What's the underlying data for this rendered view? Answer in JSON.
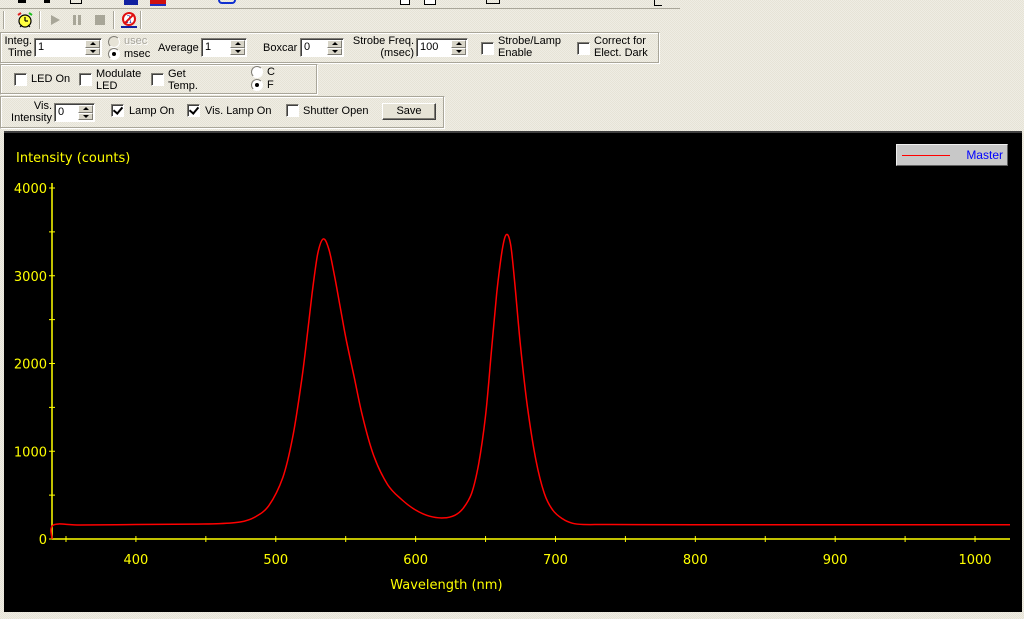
{
  "toolbar_top": {
    "icons": [
      "toolbar-icon-1",
      "toolbar-icon-2",
      "toolbar-icon-3",
      "toolbar-icon-4",
      "toolbar-icon-5",
      "toolbar-icon-6"
    ]
  },
  "toolbar_acq": {
    "buttons": [
      {
        "name": "timer-button",
        "icon": "alarm-clock-icon",
        "enabled": true
      },
      {
        "name": "play-button",
        "icon": "play-icon",
        "enabled": false
      },
      {
        "name": "pause-button",
        "icon": "pause-icon",
        "enabled": false
      },
      {
        "name": "stop-button",
        "icon": "stop-icon",
        "enabled": false
      },
      {
        "name": "no-lambda-button",
        "icon": "no-lambda-icon",
        "enabled": true
      }
    ]
  },
  "acquisition": {
    "integ_time_label_1": "Integ.",
    "integ_time_label_2": "Time",
    "integ_time_value": "1",
    "unit_usec": "usec",
    "unit_msec": "msec",
    "unit_selected": "msec",
    "average_label": "Average",
    "average_value": "1",
    "boxcar_label": "Boxcar",
    "boxcar_value": "0",
    "strobe_freq_label_1": "Strobe Freq.",
    "strobe_freq_label_2": "(msec)",
    "strobe_freq_value": "100",
    "strobe_lamp_label_1": "Strobe/Lamp",
    "strobe_lamp_label_2": "Enable",
    "strobe_lamp_checked": false,
    "correct_dark_label_1": "Correct for",
    "correct_dark_label_2": "Elect. Dark",
    "correct_dark_checked": false
  },
  "led": {
    "led_on_label": "LED On",
    "led_on_checked": false,
    "modulate_label_1": "Modulate",
    "modulate_label_2": "LED",
    "modulate_checked": false,
    "get_temp_label_1": "Get",
    "get_temp_label_2": "Temp.",
    "get_temp_checked": false,
    "temp_c_label": "C",
    "temp_f_label": "F",
    "temp_selected": "F"
  },
  "lamp": {
    "vis_intensity_label_1": "Vis.",
    "vis_intensity_label_2": "Intensity",
    "vis_intensity_value": "0",
    "lamp_on_label": "Lamp On",
    "lamp_on_checked": true,
    "vis_lamp_on_label": "Vis. Lamp On",
    "vis_lamp_on_checked": true,
    "shutter_open_label": "Shutter Open",
    "shutter_open_checked": false,
    "save_label": "Save"
  },
  "colors": {
    "plot_background": "#000000",
    "axis_color": "#ffff00",
    "series_color": "#ff0000",
    "legend_text": "#0000ff"
  },
  "chart_data": {
    "type": "line",
    "title": "",
    "ylabel": "Intensity (counts)",
    "xlabel": "Wavelength (nm)",
    "xlim": [
      340,
      1025
    ],
    "ylim": [
      0,
      4000
    ],
    "x_ticks": [
      400,
      500,
      600,
      700,
      800,
      900,
      1000
    ],
    "y_ticks": [
      0,
      1000,
      2000,
      3000,
      4000
    ],
    "x_minor_step": 50,
    "y_minor_step": 500,
    "grid": false,
    "legend": {
      "position": "top-right",
      "entries": [
        "Master"
      ]
    },
    "series": [
      {
        "name": "Master",
        "x": [
          340,
          341,
          360,
          400,
          440,
          460,
          475,
          485,
          495,
          505,
          512,
          518,
          522,
          526,
          530,
          534,
          538,
          542,
          546,
          550,
          556,
          562,
          570,
          580,
          590,
          600,
          610,
          620,
          628,
          634,
          640,
          645,
          650,
          654,
          658,
          662,
          665,
          668,
          671,
          675,
          680,
          686,
          692,
          698,
          705,
          712,
          720,
          740,
          800,
          900,
          1000,
          1025
        ],
        "values": [
          0,
          160,
          160,
          165,
          170,
          175,
          195,
          250,
          380,
          700,
          1150,
          1750,
          2250,
          2800,
          3250,
          3420,
          3300,
          3000,
          2650,
          2300,
          1850,
          1400,
          950,
          620,
          450,
          330,
          260,
          240,
          270,
          350,
          520,
          850,
          1400,
          2100,
          2800,
          3300,
          3470,
          3350,
          2900,
          2200,
          1500,
          900,
          520,
          330,
          230,
          180,
          165,
          165,
          162,
          162,
          162,
          162
        ]
      }
    ]
  }
}
